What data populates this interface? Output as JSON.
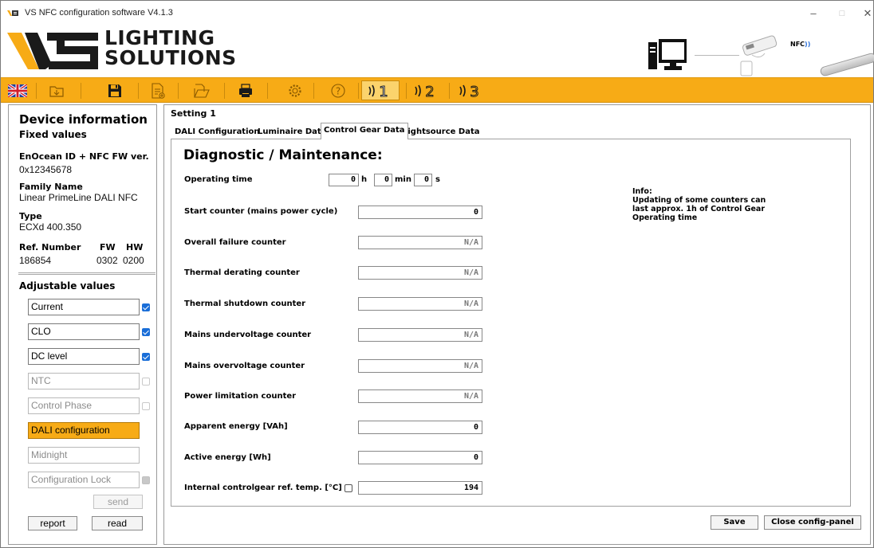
{
  "window": {
    "title": "VS NFC configuration software V4.1.3",
    "controls": [
      "minimize",
      "maximize",
      "close"
    ]
  },
  "logo": {
    "line1": "LIGHTING",
    "line2": "SOLUTIONS"
  },
  "header_graphics": {
    "nfc_label": "NFC",
    "icons": [
      "computer-icon",
      "nfc-programmer-icon",
      "linear-luminaire-icon"
    ]
  },
  "toolbar": {
    "background": "#f7ab16",
    "buttons": [
      {
        "name": "language-uk-flag-icon"
      },
      {
        "name": "open-folder-icon"
      },
      {
        "name": "save-disk-icon"
      },
      {
        "name": "new-document-icon"
      },
      {
        "name": "open-file-icon"
      },
      {
        "name": "print-icon"
      },
      {
        "name": "settings-gear-icon"
      },
      {
        "name": "help-icon"
      },
      {
        "name": "nfc-setting-1-icon",
        "label": "1"
      },
      {
        "name": "nfc-setting-2-icon",
        "label": "2"
      },
      {
        "name": "nfc-setting-3-icon",
        "label": "3"
      }
    ]
  },
  "device_info": {
    "title": "Device information",
    "fixed_values_label": "Fixed values",
    "enocean_label": "EnOcean ID + NFC FW ver.",
    "enocean_value": "0x12345678",
    "family_label": "Family Name",
    "family_value": "Linear PrimeLine DALI NFC",
    "type_label": "Type",
    "type_value": "ECXd 400.350",
    "ref_label": "Ref. Number",
    "fw_label": "FW",
    "hw_label": "HW",
    "ref_value": "186854",
    "fw_value": "0302",
    "hw_value": "0200",
    "adjustable_label": "Adjustable values",
    "adjustable": [
      {
        "label": "Current",
        "checked": true,
        "state": "enabled"
      },
      {
        "label": "CLO",
        "checked": true,
        "state": "enabled"
      },
      {
        "label": "DC level",
        "checked": true,
        "state": "enabled"
      },
      {
        "label": "NTC",
        "checked": false,
        "state": "disabled"
      },
      {
        "label": "Control Phase",
        "checked": false,
        "state": "disabled"
      },
      {
        "label": "DALI configuration",
        "checked": false,
        "state": "active"
      },
      {
        "label": "Midnight",
        "checked": false,
        "state": "disabled"
      },
      {
        "label": "Configuration Lock",
        "checked": true,
        "state": "disabled"
      }
    ],
    "send_label": "send",
    "report_label": "report",
    "read_label": "read"
  },
  "setting": {
    "title": "Setting 1",
    "tabs": [
      "DALI Configuration",
      "Luminaire Data",
      "Control Gear Data",
      "Lightsource Data"
    ],
    "active_tab": "Control Gear Data"
  },
  "diagnostics": {
    "title": "Diagnostic / Maintenance:",
    "operating_time_label": "Operating time",
    "hours": "0",
    "hours_unit": "h",
    "minutes": "0",
    "minutes_unit": "min",
    "seconds": "0",
    "seconds_unit": "s",
    "rows": [
      {
        "label": "Start counter (mains power cycle)",
        "value": "0"
      },
      {
        "label": "Overall failure counter",
        "value": "N/A"
      },
      {
        "label": "Thermal derating counter",
        "value": "N/A"
      },
      {
        "label": "Thermal shutdown counter",
        "value": "N/A"
      },
      {
        "label": "Mains undervoltage counter",
        "value": "N/A"
      },
      {
        "label": "Mains overvoltage counter",
        "value": "N/A"
      },
      {
        "label": "Power limitation counter",
        "value": "N/A"
      },
      {
        "label": "Apparent energy [VAh]",
        "value": "0"
      },
      {
        "label": "Active energy [Wh]",
        "value": "0"
      },
      {
        "label": "Internal controlgear ref. temp. [°C]",
        "value": "194"
      }
    ],
    "info": {
      "title": "Info:",
      "lines": [
        "Updating of some counters can",
        "last approx. 1h of Control Gear",
        "Operating time"
      ]
    }
  },
  "footer": {
    "save_label": "Save",
    "close_label": "Close config-panel"
  }
}
